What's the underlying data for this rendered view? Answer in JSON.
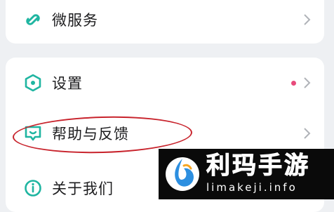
{
  "menu": {
    "items": [
      {
        "label": "微服务",
        "icon": "microservice-icon"
      },
      {
        "label": "设置",
        "icon": "settings-hexagon-icon",
        "badge_dot": true
      },
      {
        "label": "帮助与反馈",
        "icon": "help-feedback-icon"
      },
      {
        "label": "关于我们",
        "icon": "info-icon"
      }
    ]
  },
  "watermark": {
    "title": "利玛手游",
    "url": "limakeji.info"
  },
  "colors": {
    "accent": "#1fb5a1",
    "badge_dot": "#e84a7b",
    "annotation": "#c8232c",
    "chevron": "#b0b3b8"
  }
}
